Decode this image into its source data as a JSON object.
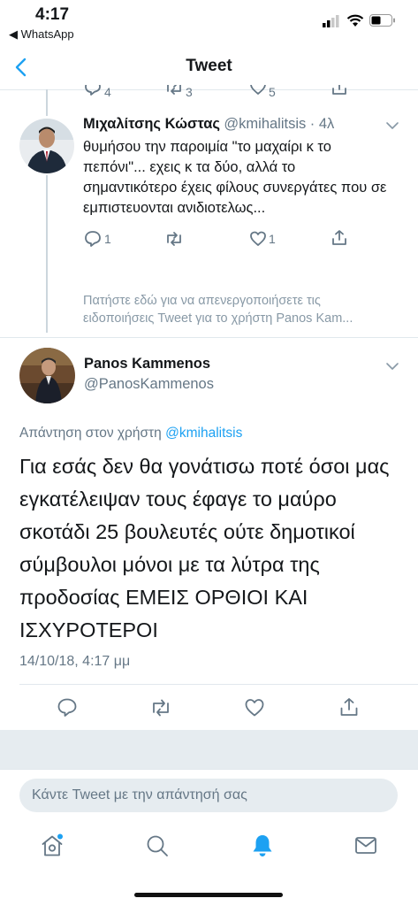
{
  "status_bar": {
    "time": "4:17",
    "back_app": "◀ WhatsApp"
  },
  "nav": {
    "title": "Tweet"
  },
  "prev_actions": {
    "reply_count": "4",
    "retweet_count": "3",
    "like_count": "5"
  },
  "reply_tweet": {
    "name": "Μιχαλίτσης Κώστας",
    "handle": "@kmihalitsis",
    "time": "· 4λ",
    "text": "θυμήσου την παροιμία \"το μαχαίρι κ το πεπόνι\"... εχεις κ τα δύο, αλλά το σημαντικότερο έχεις φίλους συνεργάτες που σε εμπιστευονται ανιδιοτελως...",
    "reply_count": "1",
    "like_count": "1"
  },
  "notice": {
    "line1": "Πατήστε εδώ για να απενεργοποιήσετε τις",
    "line2": "ειδοποιήσεις Tweet για το χρήστη Panos Kam..."
  },
  "main_tweet": {
    "name": "Panos Kammenos",
    "handle": "@PanosKammenos",
    "reply_prefix": "Απάντηση στον χρήστη",
    "reply_to": "@kmihalitsis",
    "text": "Για εσάς δεν θα γονάτισω ποτέ όσοι μας εγκατέλειψαν τους έφαγε το μαύρο σκοτάδι 25 βουλευτές ούτε δημοτικοί σύμβουλοι μόνοι με τα λύτρα της προδοσίας ΕΜΕΙΣ ΟΡΘΙΟΙ ΚΑΙ ΙΣΧΥΡΟΤΕΡΟΙ",
    "timestamp": "14/10/18, 4:17 μμ"
  },
  "reply_input": {
    "placeholder": "Κάντε Tweet με την απάντησή σας"
  },
  "colors": {
    "accent": "#1da1f2",
    "muted": "#657786",
    "divider": "#e1e8ed",
    "panel": "#e6ecf0"
  },
  "tab_bar": {
    "icons": [
      "home-icon",
      "search-icon",
      "notifications-icon",
      "messages-icon"
    ]
  }
}
